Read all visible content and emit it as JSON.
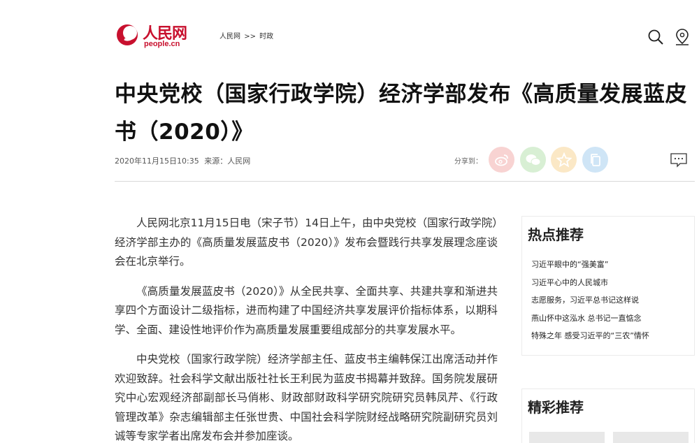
{
  "header": {
    "logo_text": "人民网",
    "logo_domain": "people.cn",
    "breadcrumb": [
      "人民网",
      ">>",
      "时政"
    ]
  },
  "article": {
    "title": "中央党校（国家行政学院）经济学部发布《高质量发展蓝皮书（2020）》",
    "datetime": "2020年11月15日10:35",
    "source": "来源：人民网",
    "share_label": "分享到：",
    "paragraphs": [
      "人民网北京11月15日电（宋子节）14日上午，由中央党校（国家行政学院）经济学部主办的《高质量发展蓝皮书（2020）》发布会暨践行共享发展理念座谈会在北京举行。",
      "《高质量发展蓝皮书（2020）》从全民共享、全面共享、共建共享和渐进共享四个方面设计二级指标，进而构建了中国经济共享发展评价指标体系，以期科学、全面、建设性地评价作为高质量发展重要组成部分的共享发展水平。",
      "中央党校（国家行政学院）经济学部主任、蓝皮书主编韩保江出席活动并作欢迎致辞。社会科学文献出版社社长王利民为蓝皮书揭幕并致辞。国务院发展研究中心宏观经济部副部长马俏彬、财政部财政科学研究院研究员韩凤芹、《行政管理改革》杂志编辑部主任张世贵、中国社会科学院财经战略研究院副研究员刘诚等专家学者出席发布会并参加座谈。"
    ]
  },
  "sidebar": {
    "hot": {
      "title": "热点推荐",
      "items": [
        "习近平眼中的“强美富”",
        "习近平心中的人民城市",
        "志愿服务，习近平总书记这样说",
        "燕山怀中这泓水 总书记一直惦念",
        "特殊之年 感受习近平的“三农”情怀"
      ]
    },
    "featured": {
      "title": "精彩推荐"
    }
  },
  "colors": {
    "brand_red": "#c8102e",
    "weibo_bg": "#f8d3d2",
    "wechat_bg": "#d8efd4",
    "favorite_bg": "#fbe8c6",
    "copy_bg": "#cfe5f6"
  }
}
